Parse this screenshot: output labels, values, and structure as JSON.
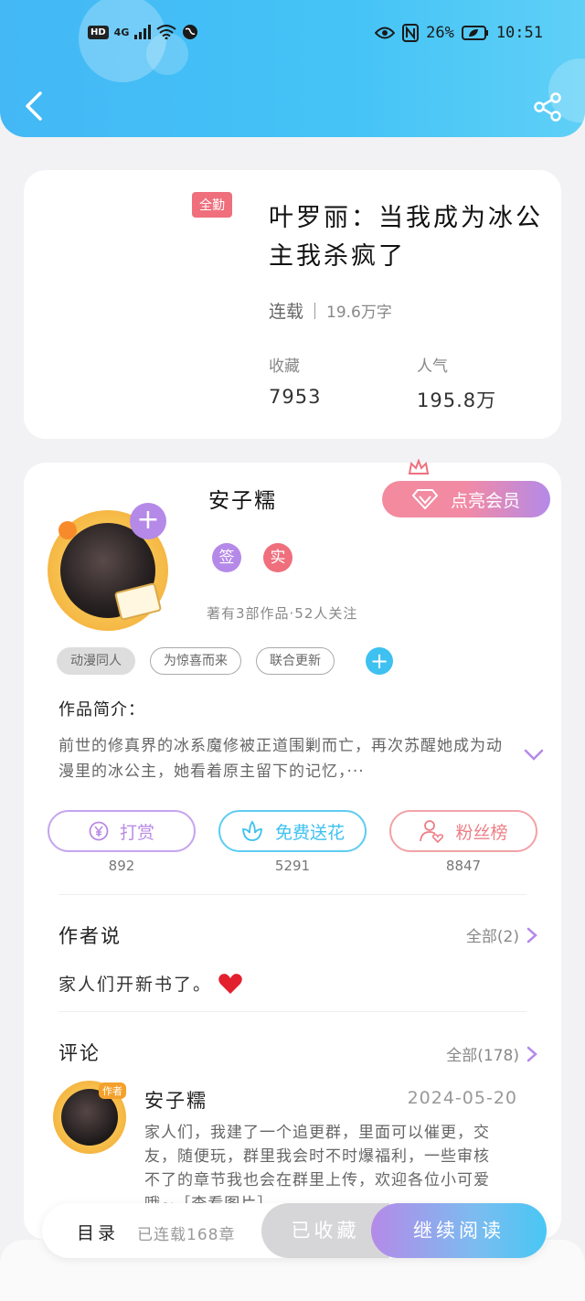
{
  "status_bar": {
    "network_hd": "HD",
    "network_gen": "4G",
    "battery": "26%",
    "time": "10:51"
  },
  "book": {
    "badge": "全勤",
    "title": "叶罗丽：当我成为冰公主我杀疯了",
    "status": "连载",
    "words": "19.6万字",
    "favorites_label": "收藏",
    "favorites_value": "7953",
    "popularity_label": "人气",
    "popularity_value": "195.8万"
  },
  "author": {
    "name": "安子糯",
    "member_button": "点亮会员",
    "badge_sign": "签",
    "badge_real": "实",
    "works_info": "著有3部作品·52人关注"
  },
  "tags": [
    "动漫同人",
    "为惊喜而来",
    "联合更新"
  ],
  "intro": {
    "title": "作品简介：",
    "text": "前世的修真界的冰系魔修被正道围剿而亡，再次苏醒她成为动漫里的冰公主，她看着原主留下的记忆，···"
  },
  "actions": [
    {
      "label": "打赏",
      "count": "892",
      "color": "#b98ae6"
    },
    {
      "label": "免费送花",
      "count": "5291",
      "color": "#3ec1f0"
    },
    {
      "label": "粉丝榜",
      "count": "8847",
      "color": "#ee7e86"
    }
  ],
  "author_says": {
    "title": "作者说",
    "more": "全部(2)",
    "text": "家人们开新书了。"
  },
  "comments": {
    "title": "评论",
    "more": "全部(178)",
    "item": {
      "tag": "作者",
      "name": "安子糯",
      "date": "2024-05-20",
      "text": "家人们，我建了一个追更群，里面可以催更，交友，随便玩，群里我会时不时爆福利，一些审核不了的章节我也会在群里上传，欢迎各位小可爱哦~［查看图片］"
    }
  },
  "bottom_bar": {
    "catalog": "目录",
    "chapters": "已连载168章",
    "collected": "已收藏",
    "continue": "继续阅读"
  }
}
